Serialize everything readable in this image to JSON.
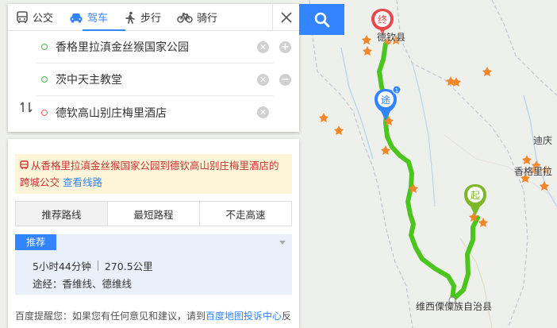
{
  "modes": [
    {
      "label": "公交",
      "icon": "bus-icon"
    },
    {
      "label": "驾车",
      "icon": "car-icon",
      "active": true
    },
    {
      "label": "步行",
      "icon": "walk-icon"
    },
    {
      "label": "骑行",
      "icon": "bike-icon"
    }
  ],
  "stops": {
    "start": "香格里拉滇金丝猴国家公园",
    "via": "茨中天主教堂",
    "end": "德钦高山别庄梅里酒店"
  },
  "notice": {
    "text": "从香格里拉滇金丝猴国家公园到德钦高山别庄梅里酒店的跨城公交",
    "link": "查看线路"
  },
  "tabs": [
    "推荐路线",
    "最短路程",
    "不走高速"
  ],
  "route": {
    "badge": "推荐",
    "duration": "5小时44分钟",
    "distance": "270.5公里",
    "via": "途经：香维线、德维线"
  },
  "tip": {
    "prefix": "百度提醒您：如果您有任何意见和建议，请到",
    "link": "百度地图投诉中心",
    "suffix": "反"
  },
  "map": {
    "labels": {
      "deqin": "德钦县",
      "diqing": "迪庆",
      "xianggelila": "香格里拉",
      "weixi": "维西傈僳族自治县"
    },
    "markers": {
      "end": "终",
      "via": "途",
      "start": "起",
      "via_index": "1"
    }
  },
  "colors": {
    "accent": "#3385ff",
    "route": "#4cc51f",
    "end_marker": "#e8474a",
    "via_marker": "#3385ff",
    "start_marker": "#7cb82a"
  }
}
